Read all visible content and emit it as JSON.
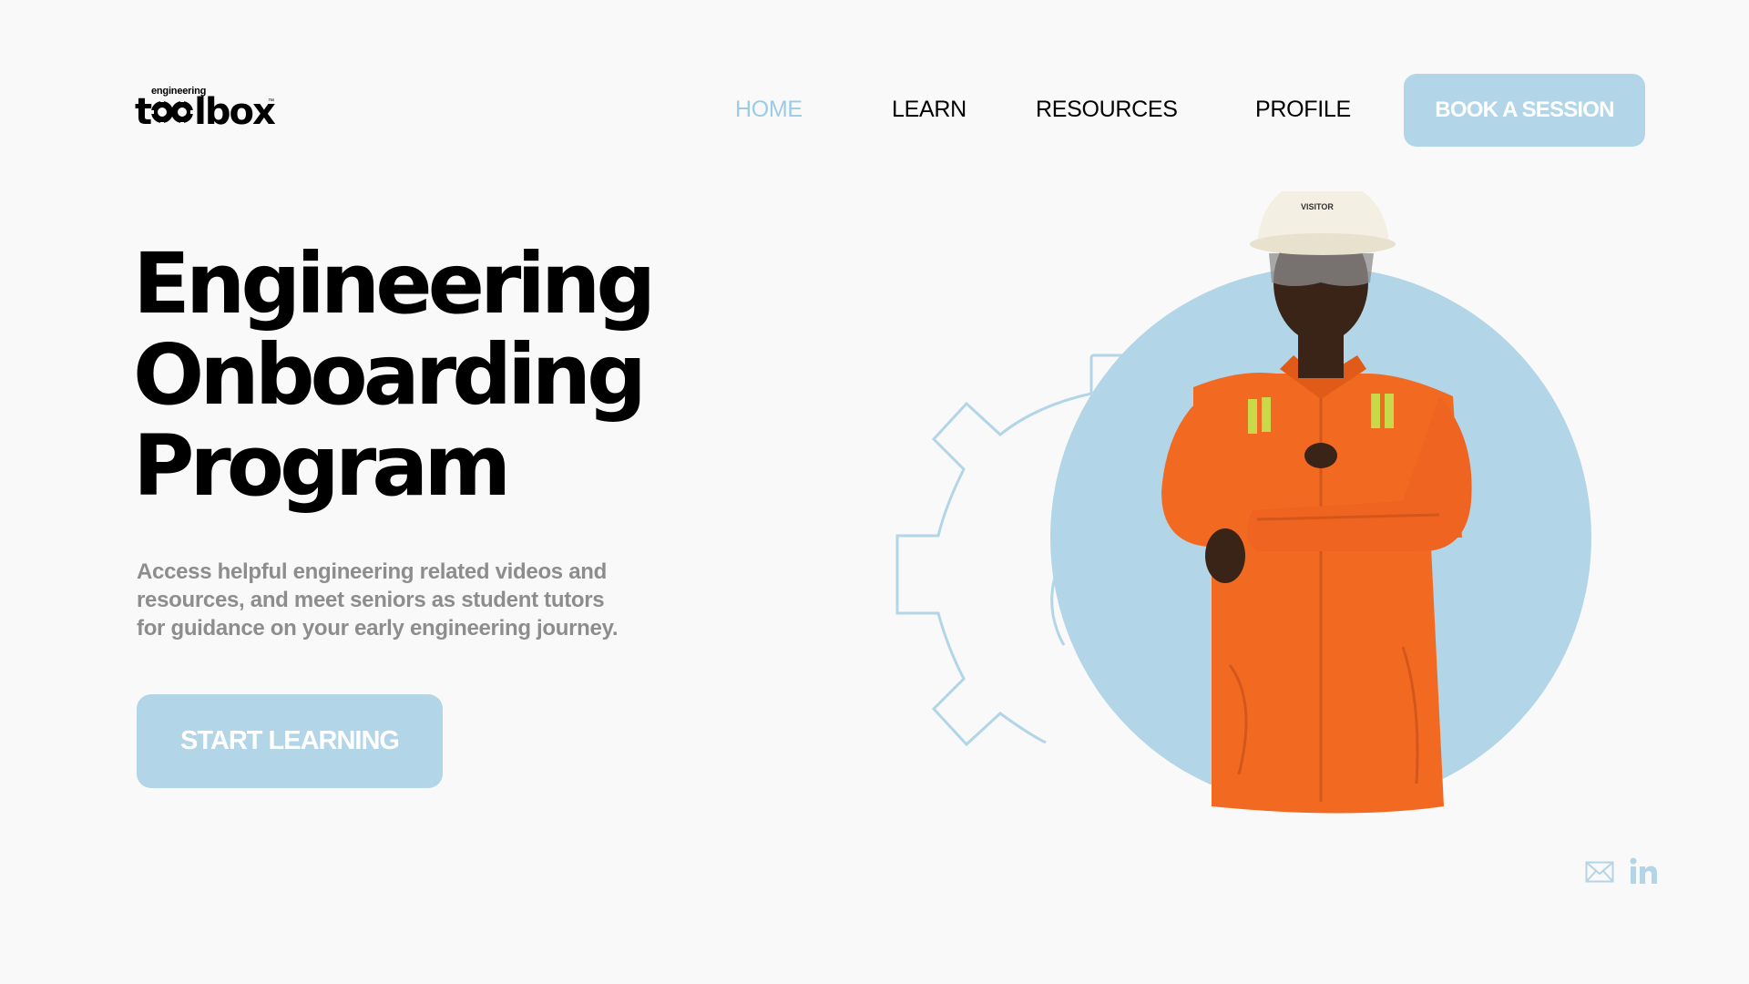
{
  "brand": {
    "logo_small": "engineering",
    "logo_main_left": "t",
    "logo_main_right": "lbox",
    "logo_tm": "™"
  },
  "nav": {
    "items": [
      {
        "label": "HOME",
        "active": true
      },
      {
        "label": "LEARN",
        "active": false
      },
      {
        "label": "RESOURCES",
        "active": false
      },
      {
        "label": "PROFILE",
        "active": false
      }
    ],
    "cta_label": "BOOK A SESSION"
  },
  "hero": {
    "title_lines": [
      "Engineering",
      "Onboarding",
      "Program"
    ],
    "description": "Access helpful engineering related videos and resources, and meet seniors as student tutors for guidance on your early engineering journey.",
    "cta_label": "START LEARNING",
    "helmet_text": "VISITOR"
  },
  "socials": {
    "items": [
      {
        "icon": "mail-icon"
      },
      {
        "icon": "linkedin-icon"
      }
    ]
  },
  "colors": {
    "background": "#f9f9f9",
    "accent": "#b2d5e8",
    "accent_text": "#9ccbe6",
    "coverall": "#f26a21",
    "description_text": "#8d8d8d"
  }
}
